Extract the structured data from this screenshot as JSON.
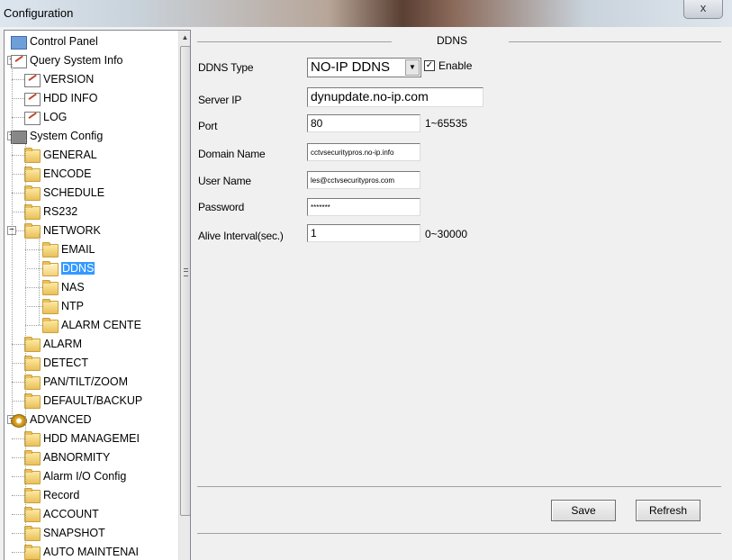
{
  "window": {
    "title": "Configuration",
    "close_glyph": "x"
  },
  "tree": [
    {
      "label": "Control Panel",
      "icon": "monitor-icon",
      "level": 0,
      "expander": ""
    },
    {
      "label": "Query System Info",
      "icon": "document-edit-icon",
      "level": 0,
      "expander": "−"
    },
    {
      "label": "VERSION",
      "icon": "document-edit-icon",
      "level": 1,
      "expander": ""
    },
    {
      "label": "HDD INFO",
      "icon": "document-edit-icon",
      "level": 1,
      "expander": ""
    },
    {
      "label": "LOG",
      "icon": "document-edit-icon",
      "level": 1,
      "expander": ""
    },
    {
      "label": "System Config",
      "icon": "system-config-icon",
      "level": 0,
      "expander": "−"
    },
    {
      "label": "GENERAL",
      "icon": "folder-icon",
      "level": 1,
      "expander": ""
    },
    {
      "label": "ENCODE",
      "icon": "folder-icon",
      "level": 1,
      "expander": ""
    },
    {
      "label": "SCHEDULE",
      "icon": "folder-icon",
      "level": 1,
      "expander": ""
    },
    {
      "label": "RS232",
      "icon": "folder-icon",
      "level": 1,
      "expander": ""
    },
    {
      "label": "NETWORK",
      "icon": "folder-icon",
      "level": 1,
      "expander": "−"
    },
    {
      "label": "EMAIL",
      "icon": "folder-icon",
      "level": 2,
      "expander": ""
    },
    {
      "label": "DDNS",
      "icon": "folder-open-icon",
      "level": 2,
      "expander": "",
      "selected": true
    },
    {
      "label": "NAS",
      "icon": "folder-icon",
      "level": 2,
      "expander": ""
    },
    {
      "label": "NTP",
      "icon": "folder-icon",
      "level": 2,
      "expander": ""
    },
    {
      "label": "ALARM CENTE",
      "icon": "folder-icon",
      "level": 2,
      "expander": ""
    },
    {
      "label": "ALARM",
      "icon": "folder-icon",
      "level": 1,
      "expander": ""
    },
    {
      "label": "DETECT",
      "icon": "folder-icon",
      "level": 1,
      "expander": ""
    },
    {
      "label": "PAN/TILT/ZOOM",
      "icon": "folder-icon",
      "level": 1,
      "expander": ""
    },
    {
      "label": "DEFAULT/BACKUP",
      "icon": "folder-icon",
      "level": 1,
      "expander": ""
    },
    {
      "label": "ADVANCED",
      "icon": "gear-icon",
      "level": 0,
      "expander": "−"
    },
    {
      "label": "HDD MANAGEMEI",
      "icon": "folder-icon",
      "level": 1,
      "expander": ""
    },
    {
      "label": "ABNORMITY",
      "icon": "folder-icon",
      "level": 1,
      "expander": ""
    },
    {
      "label": "Alarm I/O Config",
      "icon": "folder-icon",
      "level": 1,
      "expander": ""
    },
    {
      "label": "Record",
      "icon": "folder-icon",
      "level": 1,
      "expander": ""
    },
    {
      "label": "ACCOUNT",
      "icon": "folder-icon",
      "level": 1,
      "expander": ""
    },
    {
      "label": "SNAPSHOT",
      "icon": "folder-icon",
      "level": 1,
      "expander": ""
    },
    {
      "label": "AUTO MAINTENAI",
      "icon": "folder-icon",
      "level": 1,
      "expander": ""
    }
  ],
  "ddns": {
    "group_title": "DDNS",
    "type_label": "DDNS Type",
    "type_value": "NO-IP DDNS",
    "enable_label": "Enable",
    "enable_checked": true,
    "enable_check_glyph": "✓",
    "server_ip_label": "Server IP",
    "server_ip_value": "dynupdate.no-ip.com",
    "port_label": "Port",
    "port_value": "80",
    "port_range": "1~65535",
    "domain_label": "Domain Name",
    "domain_value": "cctvsecuritypros.no-ip.info",
    "user_label": "User Name",
    "user_value": "les@cctvsecuritypros.com",
    "password_label": "Password",
    "password_value": "*******",
    "alive_label": "Alive Interval(sec.)",
    "alive_value": "1",
    "alive_range": "0~30000"
  },
  "buttons": {
    "save": "Save",
    "refresh": "Refresh"
  }
}
